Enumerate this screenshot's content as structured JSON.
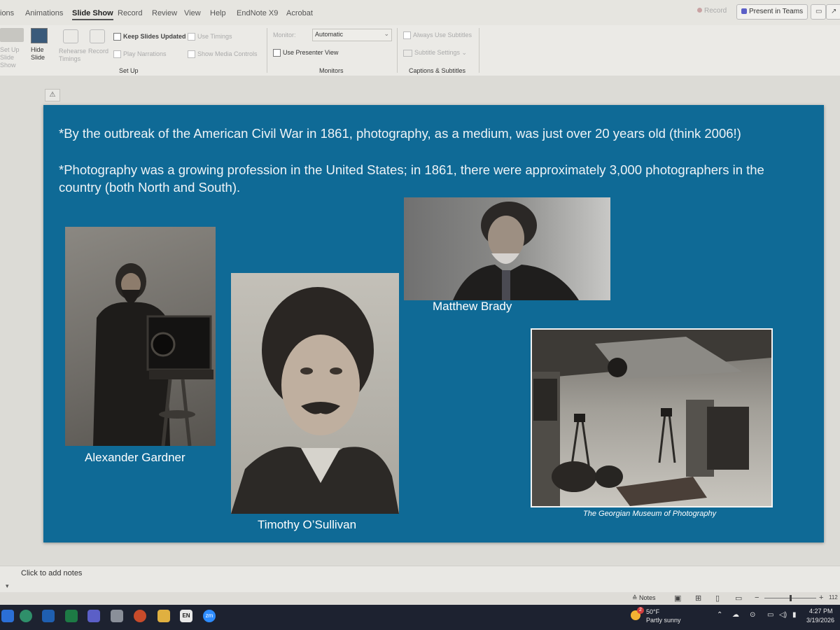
{
  "tabs": {
    "items": [
      {
        "label": "ions"
      },
      {
        "label": "Animations"
      },
      {
        "label": "Slide Show"
      },
      {
        "label": "Record"
      },
      {
        "label": "Review"
      },
      {
        "label": "View"
      },
      {
        "label": "Help"
      },
      {
        "label": "EndNote X9"
      },
      {
        "label": "Acrobat"
      }
    ],
    "record_label": "Record",
    "present_label": "Present in Teams"
  },
  "ribbon": {
    "setup_slide_show": "Set Up Slide Show",
    "hide_slide": "Hide Slide",
    "rehearse_timings": "Rehearse Timings",
    "record": "Record",
    "keep_slides_updated": "Keep Slides Updated",
    "play_narrations": "Play Narrations",
    "use_timings": "Use Timings",
    "show_media_controls": "Show Media Controls",
    "group_setup": "Set Up",
    "monitor_label": "Monitor:",
    "monitor_value": "Automatic",
    "use_presenter_view": "Use Presenter View",
    "group_monitors": "Monitors",
    "always_use_subtitles": "Always Use Subtitles",
    "subtitle_settings": "Subtitle Settings",
    "group_captions": "Captions & Subtitles"
  },
  "slide": {
    "para1": "*By the outbreak of the American Civil War in 1861, photography, as a medium, was just over 20 years old (think 2006!)",
    "para2": "*Photography was a growing profession in the United States; in 1861, there were approximately 3,000 photographers in the country (both North and South).",
    "caption_gardner": "Alexander Gardner",
    "caption_osullivan": "Timothy O’Sullivan",
    "caption_brady": "Matthew Brady",
    "caption_museum": "The Georgian Museum of Photography"
  },
  "notes": {
    "placeholder": "Click to add notes"
  },
  "status": {
    "notes_label": "Notes",
    "zoom": "112"
  },
  "taskbar": {
    "weather_temp": "50°F",
    "weather_desc": "Partly sunny",
    "weather_badge": "2",
    "time": "4:27 PM",
    "date": "3/19/2026",
    "en_label": "EN",
    "zm_label": "zm"
  }
}
